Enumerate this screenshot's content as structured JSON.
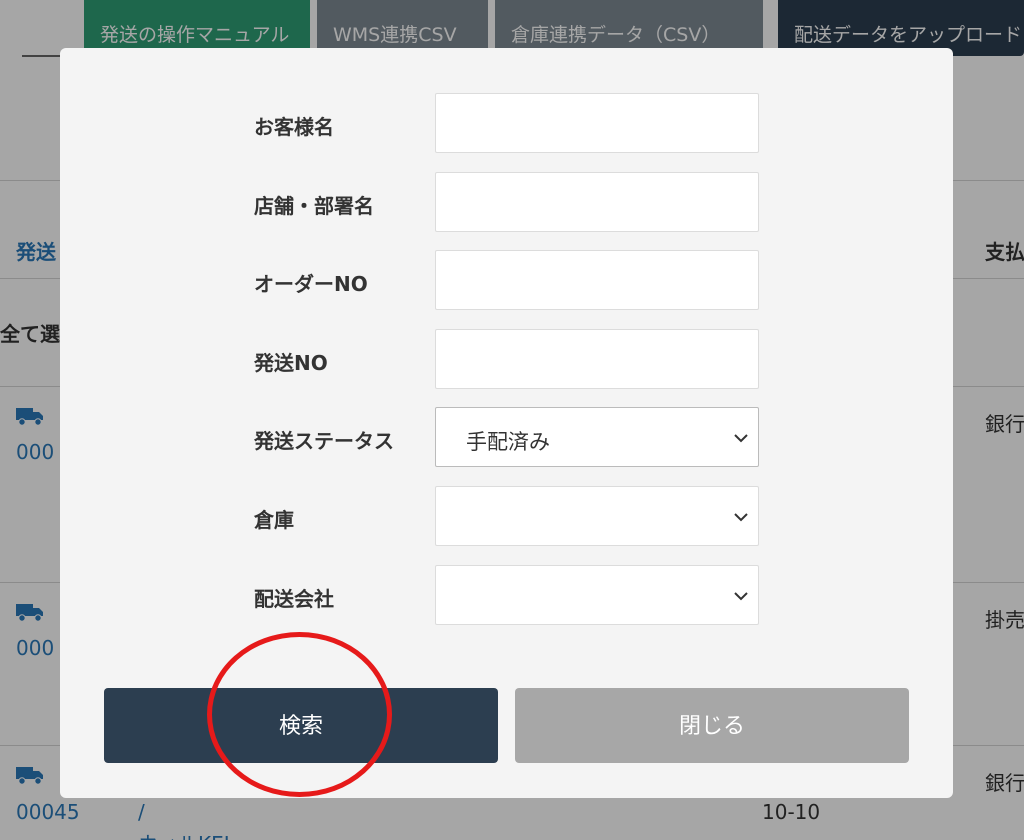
{
  "background": {
    "top_buttons": {
      "manual": "発送の操作マニュアル",
      "wms_csv": "WMS連携CSV",
      "warehouse_csv": "倉庫連携データ（CSV）",
      "upload": "配送データをアップロード"
    },
    "columns": {
      "shipping": "発送",
      "payment": "支払"
    },
    "select_all": "全て選",
    "rows": [
      {
        "number": "000",
        "payment": "銀行"
      },
      {
        "number": "000",
        "payment": "掛売"
      },
      {
        "number": "00045",
        "payment": "銀行",
        "slash": "/",
        "date": "10-10",
        "partial": "ウィルKEI"
      }
    ],
    "colors": {
      "accent_green": "#2e9e76",
      "link_blue": "#2a78b8",
      "dark_navy": "#2c3e50"
    }
  },
  "modal": {
    "fields": [
      {
        "label": "お客様名",
        "value": ""
      },
      {
        "label": "店舗・部署名",
        "value": ""
      },
      {
        "label": "オーダーNO",
        "value": ""
      },
      {
        "label": "発送NO",
        "value": ""
      }
    ],
    "status": {
      "label": "発送ステータス",
      "value": "手配済み"
    },
    "warehouse": {
      "label": "倉庫",
      "value": ""
    },
    "carrier": {
      "label": "配送会社",
      "value": ""
    },
    "search_button": "検索",
    "close_button": "閉じる",
    "icons": {
      "dropdown": "chevron-down-icon",
      "truck": "truck-icon"
    },
    "highlight_color": "#e61a1a"
  }
}
